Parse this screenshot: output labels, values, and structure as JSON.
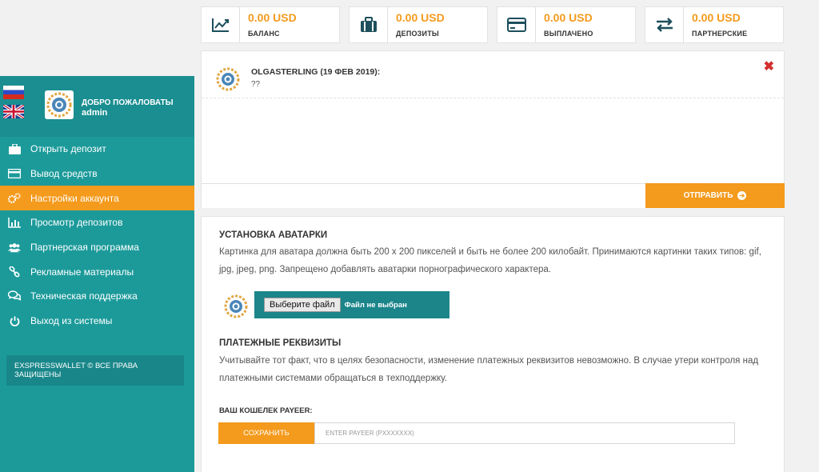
{
  "stats": [
    {
      "value": "0.00 USD",
      "label": "БАЛАНС",
      "icon": "chart-up-icon"
    },
    {
      "value": "0.00 USD",
      "label": "ДЕПОЗИТЫ",
      "icon": "briefcase-icon"
    },
    {
      "value": "0.00 USD",
      "label": "ВЫПЛАЧЕНО",
      "icon": "credit-card-icon"
    },
    {
      "value": "0.00 USD",
      "label": "ПАРТНЕРСКИЕ",
      "icon": "exchange-arrows-icon"
    }
  ],
  "sidebar": {
    "welcome": "ДОБРО ПОЖАЛОВАТЫ",
    "username": "admin",
    "menu": [
      {
        "label": "Открыть депозит",
        "icon": "briefcase-icon"
      },
      {
        "label": "Вывод средств",
        "icon": "credit-card-icon"
      },
      {
        "label": "Настройки аккаунта",
        "icon": "gears-icon",
        "active": true
      },
      {
        "label": "Просмотр депозитов",
        "icon": "bar-chart-icon"
      },
      {
        "label": "Партнерская программа",
        "icon": "users-icon"
      },
      {
        "label": "Рекламные материалы",
        "icon": "link-icon"
      },
      {
        "label": "Техническая поддержка",
        "icon": "chat-bubbles-icon"
      },
      {
        "label": "Выход из системы",
        "icon": "power-icon"
      }
    ],
    "copyright": "EXSPRESSWALLET © ВСЕ ПРАВА ЗАЩИЩЕНЫ"
  },
  "chat": {
    "author": "OLGASTERLING (19 ФЕВ 2019):",
    "message": "??",
    "send_label": "ОТПРАВИТЬ"
  },
  "avatar_section": {
    "title": "УСТАНОВКА АВАТАРКИ",
    "text": "Картинка для аватара должна быть 200 x 200 пикселей и быть не более 200 килобайт. Принимаются картинки таких типов: gif, jpg, jpeg, png. Запрещено добавлять аватарки порнографического характера.",
    "file_button": "Выберите файл",
    "file_status": "Файл не выбран"
  },
  "payment_section": {
    "title": "ПЛАТЕЖНЫЕ РЕКВИЗИТЫ",
    "text": "Учитывайте тот факт, что в целях безопасности, изменение платежных реквизитов невозможно. В случае утери контроля над платежными системами обращаться в техподдержку.",
    "wallet_label": "ВАШ КОШЕЛЕК PAYEER:",
    "save_label": "СОХРАНИТЬ",
    "payeer_placeholder": "ENTER PAYEER (PXXXXXXX)"
  },
  "colors": {
    "accent": "#f49a1c",
    "sidebar": "#1c9a9a",
    "dark_teal": "#1b858a",
    "icon": "#1d4f5c",
    "close": "#d32f2f"
  }
}
